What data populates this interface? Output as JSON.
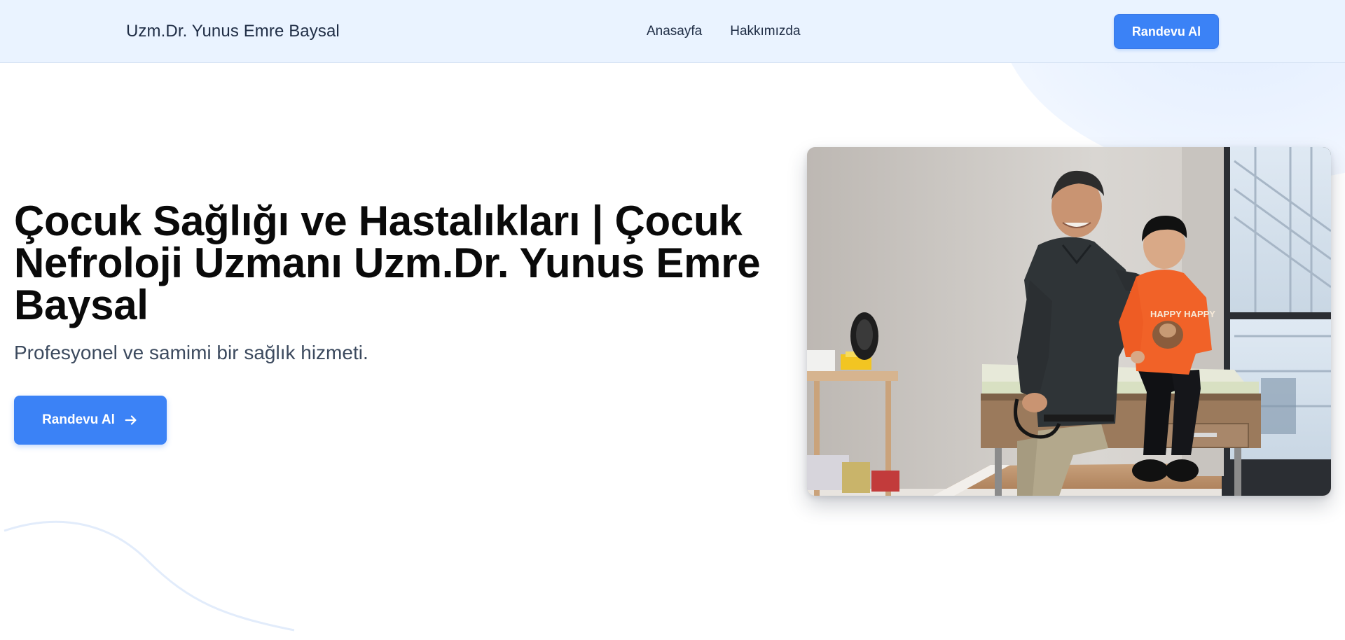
{
  "header": {
    "brand": "Uzm.Dr. Yunus Emre Baysal",
    "nav": [
      {
        "label": "Anasayfa"
      },
      {
        "label": "Hakkımızda"
      }
    ],
    "cta_label": "Randevu Al"
  },
  "hero": {
    "title": "Çocuk Sağlığı ve Hastalıkları | Çocuk Nefroloji Uzmanı Uzm.Dr. Yunus Emre Baysal",
    "subtitle": "Profesyonel ve samimi bir sağlık hizmeti.",
    "cta_label": "Randevu Al",
    "cta_icon": "arrow-right-icon"
  },
  "photo": {
    "shirt_text": "HAPPY HAPPY"
  },
  "colors": {
    "accent": "#3b82f6",
    "header_bg": "#eaf3ff",
    "title": "#0a0a0a",
    "subtitle": "#3c4a5e"
  }
}
